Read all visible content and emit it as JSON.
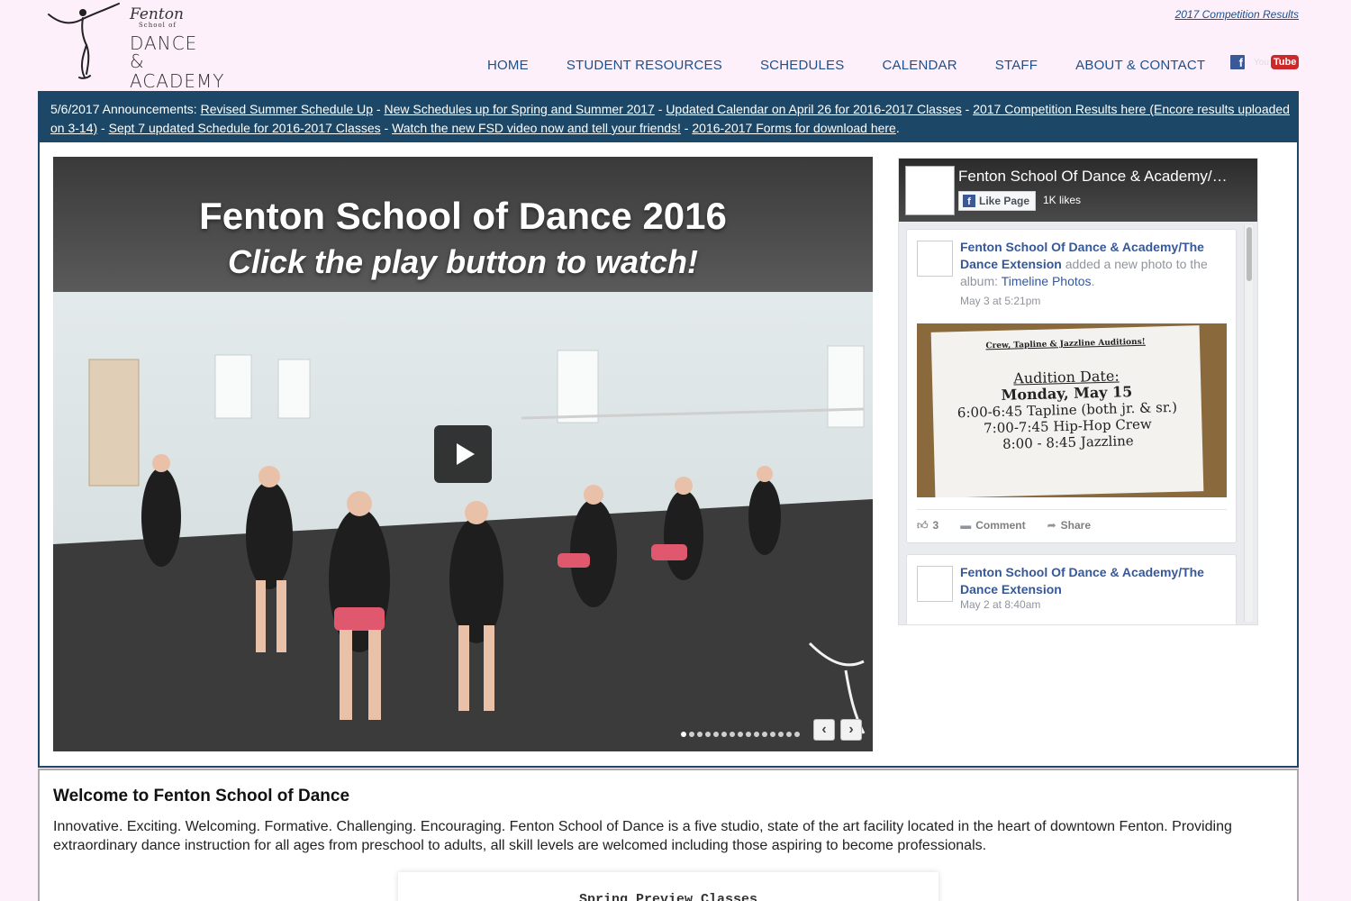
{
  "header": {
    "logo": {
      "line1": "Fenton",
      "line2": "School of",
      "line3": "DANCE &",
      "line4": "ACADEMY"
    },
    "top_link": "2017 Competition Results",
    "nav": [
      {
        "label": "HOME"
      },
      {
        "label": "STUDENT RESOURCES"
      },
      {
        "label": "SCHEDULES"
      },
      {
        "label": "CALENDAR"
      },
      {
        "label": "STAFF"
      },
      {
        "label": "ABOUT & CONTACT"
      }
    ],
    "social": {
      "facebook": "f",
      "youtube_prefix": "You",
      "youtube_tube": "Tube"
    }
  },
  "announcement": {
    "prefix": "5/6/2017 Announcements: ",
    "links": [
      "Revised Summer Schedule Up",
      "New Schedules up for Spring and Summer 2017",
      "Updated Calendar on April 26 for 2016-2017 Classes",
      "2017 Competition Results here (Encore results uploaded on 3-14)",
      "Sept 7 updated Schedule for 2016-2017 Classes",
      "Watch the new FSD video now and tell your friends!",
      "2016-2017 Forms for download here"
    ],
    "separator": " - ",
    "suffix": "."
  },
  "video": {
    "title": "Fenton School of Dance 2016",
    "subtitle": "Click the play button to watch!",
    "slide_count": 15,
    "active_slide": 1
  },
  "facebook": {
    "page_name": "Fenton School Of Dance & Academy/The Dance Extension",
    "like_label": "Like Page",
    "likes": "1K likes",
    "posts": [
      {
        "author": "Fenton School Of Dance & Academy/The Dance Extension",
        "action": " added a new photo to the album: ",
        "album": "Timeline Photos",
        "time": "May 3 at 5:21pm",
        "photo": {
          "heading": "Crew, Tapline & Jazzline Auditions!",
          "date_label": "Audition Date:",
          "date": "Monday, May 15",
          "lines": [
            "6:00-6:45 Tapline (both jr. & sr.)",
            "7:00-7:45 Hip-Hop Crew",
            "8:00 - 8:45 Jazzline"
          ]
        },
        "likes": "3",
        "comment_label": "Comment",
        "share_label": "Share"
      },
      {
        "author": "Fenton School Of Dance & Academy/The Dance Extension",
        "time": "May 2 at 8:40am"
      }
    ]
  },
  "welcome": {
    "title": "Welcome to Fenton School of Dance",
    "body": "Innovative. Exciting. Welcoming. Formative. Challenging. Encouraging. Fenton School of Dance is a five studio, state of the art facility located in the heart of downtown Fenton. Providing extraordinary dance instruction for all ages from preschool to adults, all skill levels are welcomed including those aspiring to become professionals.",
    "preview_title": "Spring Preview Classes"
  },
  "colors": {
    "page_bg": "#fdf0fb",
    "nav_text": "#1d4f8a",
    "announce_bg": "#1c4766",
    "fb_link": "#365899"
  }
}
